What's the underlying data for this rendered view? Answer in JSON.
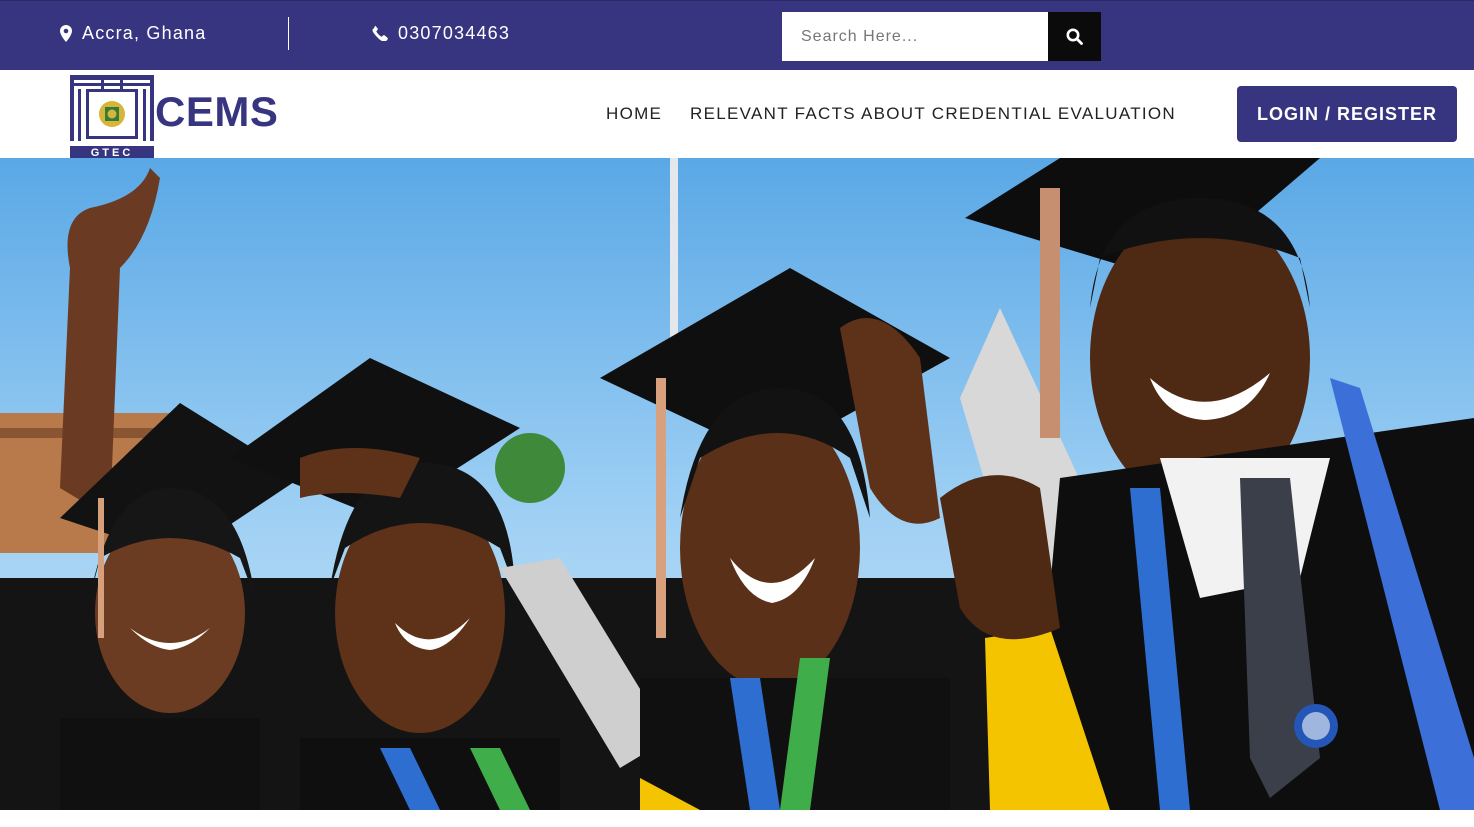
{
  "topbar": {
    "location": "Accra, Ghana",
    "phone": "0307034463",
    "search_placeholder": "Search Here...",
    "icons": [
      "map-marker-icon",
      "phone-icon",
      "search-icon"
    ],
    "background_color": "#373580"
  },
  "header": {
    "logo_text": "CEMS",
    "logo_subtext": "GTEC",
    "nav": [
      {
        "label": "HOME"
      },
      {
        "label": "RELEVANT FACTS ABOUT CREDENTIAL EVALUATION"
      }
    ],
    "login_label": "LOGIN / REGISTER",
    "accent_color": "#373580"
  },
  "hero": {
    "image": "graduates-celebrating-photo"
  }
}
